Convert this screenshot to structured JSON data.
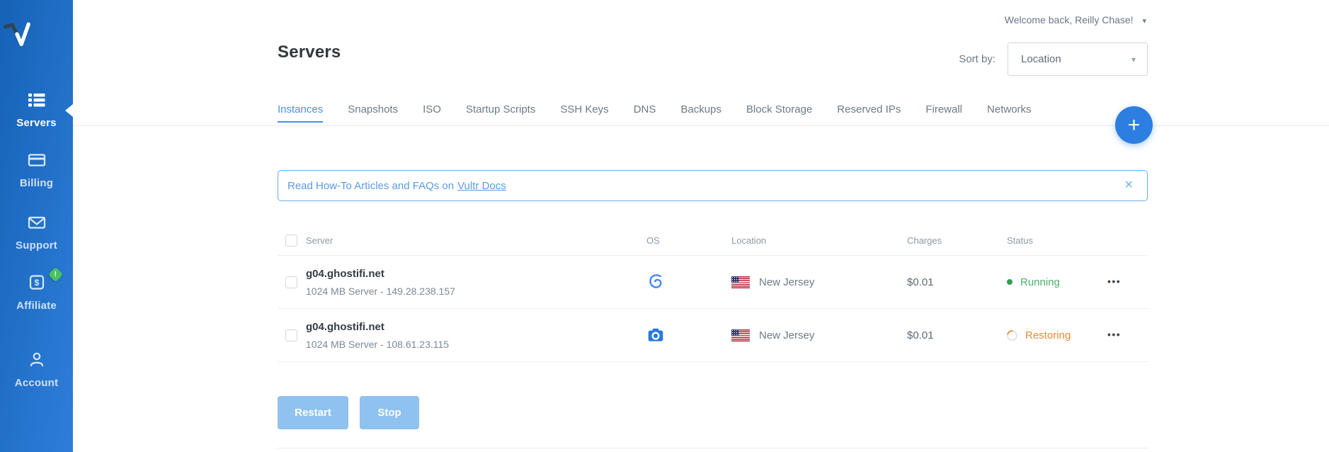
{
  "sidebar": {
    "items": [
      {
        "label": "Servers",
        "active": true
      },
      {
        "label": "Billing",
        "active": false
      },
      {
        "label": "Support",
        "active": false
      },
      {
        "label": "Affiliate",
        "active": false,
        "badge": "!"
      },
      {
        "label": "Account",
        "active": false
      }
    ]
  },
  "header": {
    "welcome": "Welcome back, Reilly Chase!",
    "title": "Servers",
    "sort_label": "Sort by:",
    "sort_value": "Location"
  },
  "tabs": [
    {
      "label": "Instances",
      "active": true
    },
    {
      "label": "Snapshots",
      "active": false
    },
    {
      "label": "ISO",
      "active": false
    },
    {
      "label": "Startup Scripts",
      "active": false
    },
    {
      "label": "SSH Keys",
      "active": false
    },
    {
      "label": "DNS",
      "active": false
    },
    {
      "label": "Backups",
      "active": false
    },
    {
      "label": "Block Storage",
      "active": false
    },
    {
      "label": "Reserved IPs",
      "active": false
    },
    {
      "label": "Firewall",
      "active": false
    },
    {
      "label": "Networks",
      "active": false
    }
  ],
  "banner": {
    "text": "Read How-To Articles and FAQs on",
    "link": "Vultr Docs"
  },
  "table": {
    "columns": {
      "server": "Server",
      "os": "OS",
      "location": "Location",
      "charges": "Charges",
      "status": "Status"
    },
    "rows": [
      {
        "name": "g04.ghostifi.net",
        "description": "1024 MB Server - 149.28.238.157",
        "os_icon": "debian-logo-icon",
        "location": "New Jersey",
        "charges": "$0.01",
        "status": "Running",
        "status_type": "running"
      },
      {
        "name": "g04.ghostifi.net",
        "description": "1024 MB Server - 108.61.23.115",
        "os_icon": "snapshot-camera-icon",
        "location": "New Jersey",
        "charges": "$0.01",
        "status": "Restoring",
        "status_type": "restoring"
      }
    ]
  },
  "actions": {
    "restart": "Restart",
    "stop": "Stop"
  },
  "icons": {
    "welcome_caret": "▾",
    "select_caret": "▾",
    "plus": "+",
    "close": "✕",
    "ellipsis": "•••",
    "dollar": "$",
    "exclamation": "!"
  },
  "colors": {
    "sidebar_gradient_start": "#1562b7",
    "sidebar_gradient_end": "#2e7ed9",
    "accent_blue": "#2c7ee1",
    "active_tab": "#4a90e2",
    "banner_blue": "#5b9be4",
    "status_running": "#4caf6e",
    "status_restoring": "#ed8936"
  }
}
